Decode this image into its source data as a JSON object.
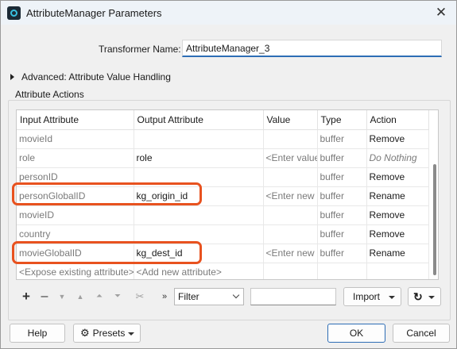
{
  "window": {
    "title": "AttributeManager Parameters"
  },
  "transformer": {
    "label": "Transformer Name:",
    "value": "AttributeManager_3"
  },
  "advanced": {
    "label": "Advanced: Attribute Value Handling"
  },
  "attribute_actions": {
    "group_label": "Attribute Actions",
    "columns": [
      "Input Attribute",
      "Output Attribute",
      "Value",
      "Type",
      "Action"
    ],
    "rows": [
      {
        "input": "movieId",
        "output": "",
        "value": "",
        "type": "buffer",
        "action": "Remove"
      },
      {
        "input": "role",
        "output": "role",
        "value": "<Enter value",
        "type": "buffer",
        "action": "Do Nothing"
      },
      {
        "input": "personID",
        "output": "",
        "value": "",
        "type": "buffer",
        "action": "Remove"
      },
      {
        "input": "personGlobalID",
        "output": "kg_origin_id",
        "value": "<Enter new v",
        "type": "buffer",
        "action": "Rename"
      },
      {
        "input": "movieID",
        "output": "",
        "value": "",
        "type": "buffer",
        "action": "Remove"
      },
      {
        "input": "country",
        "output": "",
        "value": "",
        "type": "buffer",
        "action": "Remove"
      },
      {
        "input": "movieGlobalID",
        "output": "kg_dest_id",
        "value": "<Enter new v",
        "type": "buffer",
        "action": "Rename"
      }
    ],
    "footer_row": {
      "input": "<Expose existing attribute>",
      "output": "<Add new attribute>"
    }
  },
  "toolbar": {
    "add_icon": "plus-icon",
    "remove_icon": "minus-icon",
    "filter_value": "Filter",
    "filter_text": "",
    "import_label": "Import",
    "refresh_icon": "refresh-icon"
  },
  "buttons": {
    "help": "Help",
    "presets": "Presets",
    "ok": "OK",
    "cancel": "Cancel"
  },
  "colors": {
    "highlight": "#e8521f",
    "focus_blue": "#2d6db5"
  }
}
